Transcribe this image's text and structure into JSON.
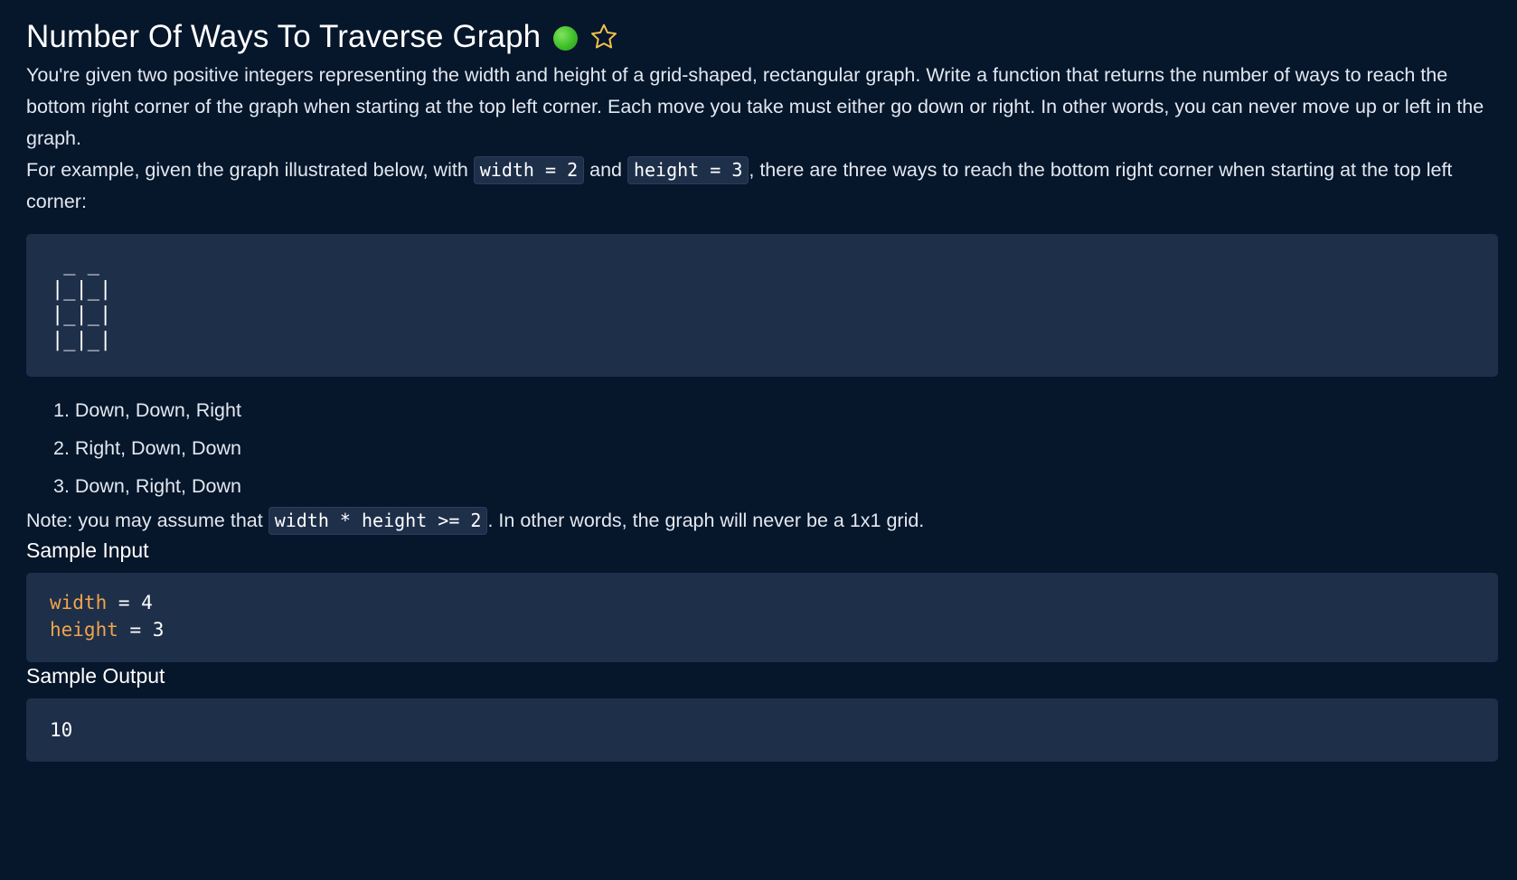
{
  "problem": {
    "title": "Number Of Ways To Traverse Graph",
    "difficulty_color": "#3fbf2a",
    "star_icon": "star-outline-icon",
    "star_color": "#f2c14e"
  },
  "description": {
    "p1": "You're given two positive integers representing the width and height of a grid-shaped, rectangular graph. Write a function that returns the number of ways to reach the bottom right corner of the graph when starting at the top left corner. Each move you take must either go down or right. In other words, you can never move up or left in the graph.",
    "p2_before": "For example, given the graph illustrated below, with ",
    "p2_code1": "width = 2",
    "p2_between": " and ",
    "p2_code2": "height = 3",
    "p2_after": ", there are three ways to reach the bottom right corner when starting at the top left corner:",
    "diagram": " _ _\n|_|_|\n|_|_|\n|_|_|",
    "ways": [
      "Down, Down, Right",
      "Right, Down, Down",
      "Down, Right, Down"
    ],
    "note_before": "Note: you may assume that ",
    "note_code": "width * height >= 2",
    "note_after": ". In other words, the graph will never be a 1x1 grid."
  },
  "sample_input": {
    "heading": "Sample Input",
    "lines": [
      {
        "name": "width",
        "op": " = ",
        "value": "4"
      },
      {
        "name": "height",
        "op": " = ",
        "value": "3"
      }
    ]
  },
  "sample_output": {
    "heading": "Sample Output",
    "value": "10"
  }
}
